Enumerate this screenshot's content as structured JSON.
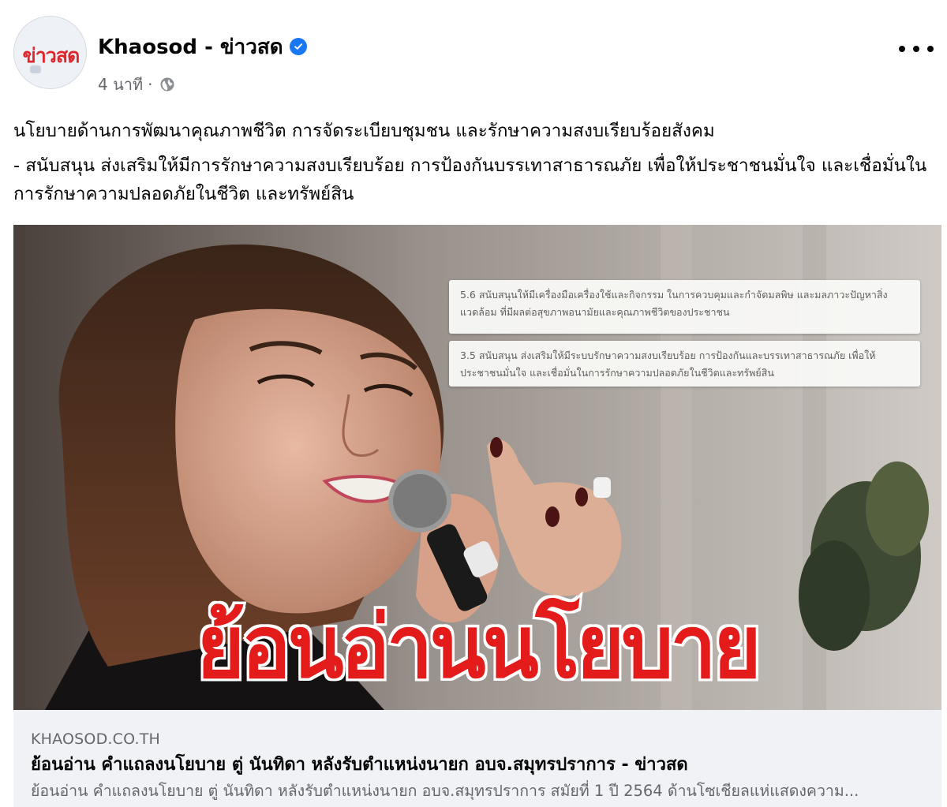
{
  "post": {
    "page_name": "Khaosod - ข่าวสด",
    "avatar_text": "ข่าวสด",
    "timestamp": "4 นาที",
    "separator": "·",
    "audience_icon": "globe-icon",
    "verified_icon": "verified-badge-icon",
    "more_icon": "more-options-icon"
  },
  "body": {
    "line1": "นโยบายด้านการพัฒนาคุณภาพชีวิต การจัดระเบียบชุมชน และรักษาความสงบเรียบร้อยสังคม",
    "line2": "- สนับสนุน ส่งเสริมให้มีการรักษาความสงบเรียบร้อย การป้องกันบรรเทาสาธารณภัย เพื่อให้ประชาชนมั่นใจ และเชื่อมั่นในการรักษาความปลอดภัยในชีวิต และทรัพย์สิน"
  },
  "image": {
    "box1": "5.6 สนับสนุนให้มีเครื่องมือเครื่องใช้และกิจกรรม ในการควบคุมและกำจัดมลพิษ และมลภาวะปัญหาสิ่งแวดล้อม ที่มีผลต่อสุขภาพอนามัยและคุณภาพชีวิตของประชาชน",
    "box2": "3.5 สนับสนุน ส่งเสริมให้มีระบบรักษาความสงบเรียบร้อย การป้องกันและบรรเทาสาธารณภัย เพื่อให้ประชาชนมั่นใจ และเชื่อมั่นในการรักษาความปลอดภัยในชีวิตและทรัพย์สิน",
    "headline": "ย้อนอ่านนโยบาย"
  },
  "link": {
    "domain": "KHAOSOD.CO.TH",
    "title": "ย้อนอ่าน คำแถลงนโยบาย ตู่ นันทิดา หลังรับตำแหน่งนายก อบจ.สมุทรปราการ - ข่าวสด",
    "description": "ย้อนอ่าน คำแถลงนโยบาย ตู่ นันทิดา หลังรับตำแหน่งนายก อบจ.สมุทรปราการ สมัยที่ 1 ปี 2564 ด้านโซเชียลแห่แสดงความ..."
  },
  "colors": {
    "verified": "#1877f2",
    "secondary_text": "#65676b",
    "headline_red": "#e41b1b",
    "preview_bg": "#f0f2f5"
  }
}
